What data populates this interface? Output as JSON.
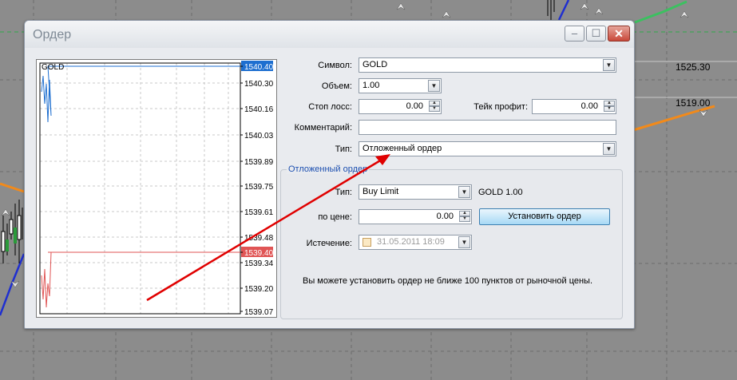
{
  "background_chart": {
    "price_labels": [
      "1525.30",
      "1519.00"
    ]
  },
  "window": {
    "title": "Ордер",
    "controls": {
      "minimize": "–",
      "maximize": "☐",
      "close": "✕"
    }
  },
  "mini_chart": {
    "symbol": "GOLD",
    "ticks": [
      "1540.40",
      "1540.30",
      "1540.16",
      "1540.03",
      "1539.89",
      "1539.75",
      "1539.61",
      "1539.48",
      "1539.40",
      "1539.34",
      "1539.20",
      "1539.07"
    ],
    "ask_label": "1540.40",
    "bid_label": "1539.40",
    "colors": {
      "ask": "#1e6fd0",
      "bid": "#e05555"
    }
  },
  "form": {
    "symbol_label": "Символ:",
    "symbol_value": "GOLD",
    "volume_label": "Объем:",
    "volume_value": "1.00",
    "sl_label": "Стоп лосс:",
    "sl_value": "0.00",
    "tp_label": "Тейк профит:",
    "tp_value": "0.00",
    "comment_label": "Комментарий:",
    "comment_value": "",
    "type_label": "Тип:",
    "type_value": "Отложенный ордер"
  },
  "pending": {
    "group_title": "Отложенный ордер",
    "type_label": "Тип:",
    "type_value": "Buy Limit",
    "type_info": "GOLD 1.00",
    "price_label": "по цене:",
    "price_value": "0.00",
    "place_button": "Установить ордер",
    "expiry_label": "Истечение:",
    "expiry_value": "31.05.2011 18:09",
    "note": "Вы можете установить ордер не ближе 100 пунктов от рыночной цены."
  },
  "annotation": {
    "color": "#e00000"
  }
}
